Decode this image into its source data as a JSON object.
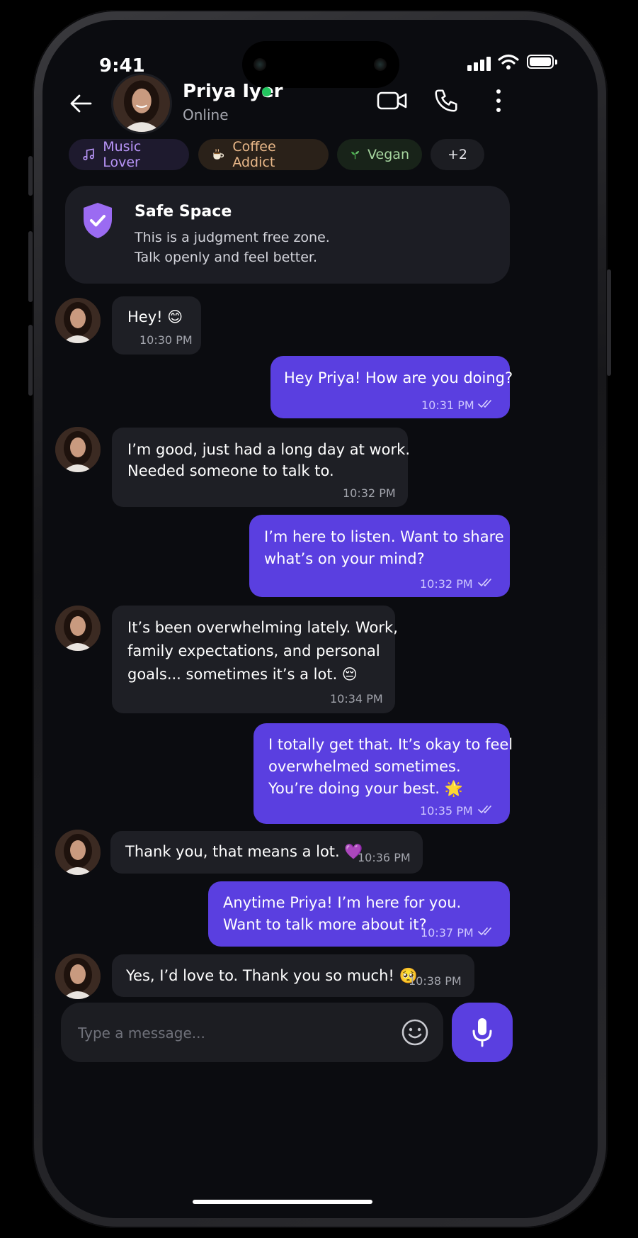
{
  "status_bar": {
    "time": "9:41"
  },
  "header": {
    "contact_name": "Priya Iyer",
    "status": "Online"
  },
  "tags": [
    {
      "label": "Music Lover",
      "color": "#b794f6",
      "bg": "#1e1a2e"
    },
    {
      "label": "Coffee Addict",
      "color": "#e9b889",
      "bg": "#2a2119"
    },
    {
      "label": "Vegan",
      "color": "#a7d6a0",
      "bg": "#182319"
    },
    {
      "label": "+2",
      "color": "#e5e5ea",
      "bg": "#1c1d22"
    }
  ],
  "safe_space": {
    "title": "Safe Space",
    "line1": "This is a judgment free zone.",
    "line2": "Talk openly and feel better."
  },
  "messages": [
    {
      "from": "contact",
      "lines": [
        "Hey! 😊"
      ],
      "time": "10:30 PM"
    },
    {
      "from": "me",
      "lines": [
        "Hey Priya! How are you doing?"
      ],
      "time": "10:31 PM",
      "read": true
    },
    {
      "from": "contact",
      "lines": [
        "I’m good, just had a long day at work.",
        "Needed someone to talk to."
      ],
      "time": "10:32 PM"
    },
    {
      "from": "me",
      "lines": [
        "I’m here to listen. Want to share",
        "what’s on your mind?"
      ],
      "time": "10:32 PM",
      "read": true
    },
    {
      "from": "contact",
      "lines": [
        "It’s been overwhelming lately. Work,",
        "family expectations, and personal",
        "goals... sometimes it’s a lot. 😔"
      ],
      "time": "10:34 PM"
    },
    {
      "from": "me",
      "lines": [
        "I totally get that. It’s okay to feel",
        "overwhelmed sometimes.",
        "You’re doing your best. 🌟"
      ],
      "time": "10:35 PM",
      "read": true
    },
    {
      "from": "contact",
      "lines": [
        "Thank you, that means a lot. 💜"
      ],
      "time": "10:36 PM"
    },
    {
      "from": "me",
      "lines": [
        "Anytime Priya! I’m here for you.",
        "Want to talk more about it?"
      ],
      "time": "10:37 PM",
      "read": true
    },
    {
      "from": "contact",
      "lines": [
        "Yes, I’d love to. Thank you so much! 🥺"
      ],
      "time": "10:38 PM"
    }
  ],
  "composer": {
    "placeholder": "Type a message..."
  },
  "colors": {
    "accent": "#5a3fe0",
    "online": "#22c55e",
    "background": "#0b0c10",
    "incoming_bubble": "#1e1f25"
  },
  "icons": [
    "back-arrow-icon",
    "video-call-icon",
    "phone-call-icon",
    "more-vertical-icon",
    "music-note-icon",
    "coffee-icon",
    "sprout-icon",
    "shield-check-icon",
    "double-check-icon",
    "emoji-icon",
    "microphone-icon"
  ]
}
